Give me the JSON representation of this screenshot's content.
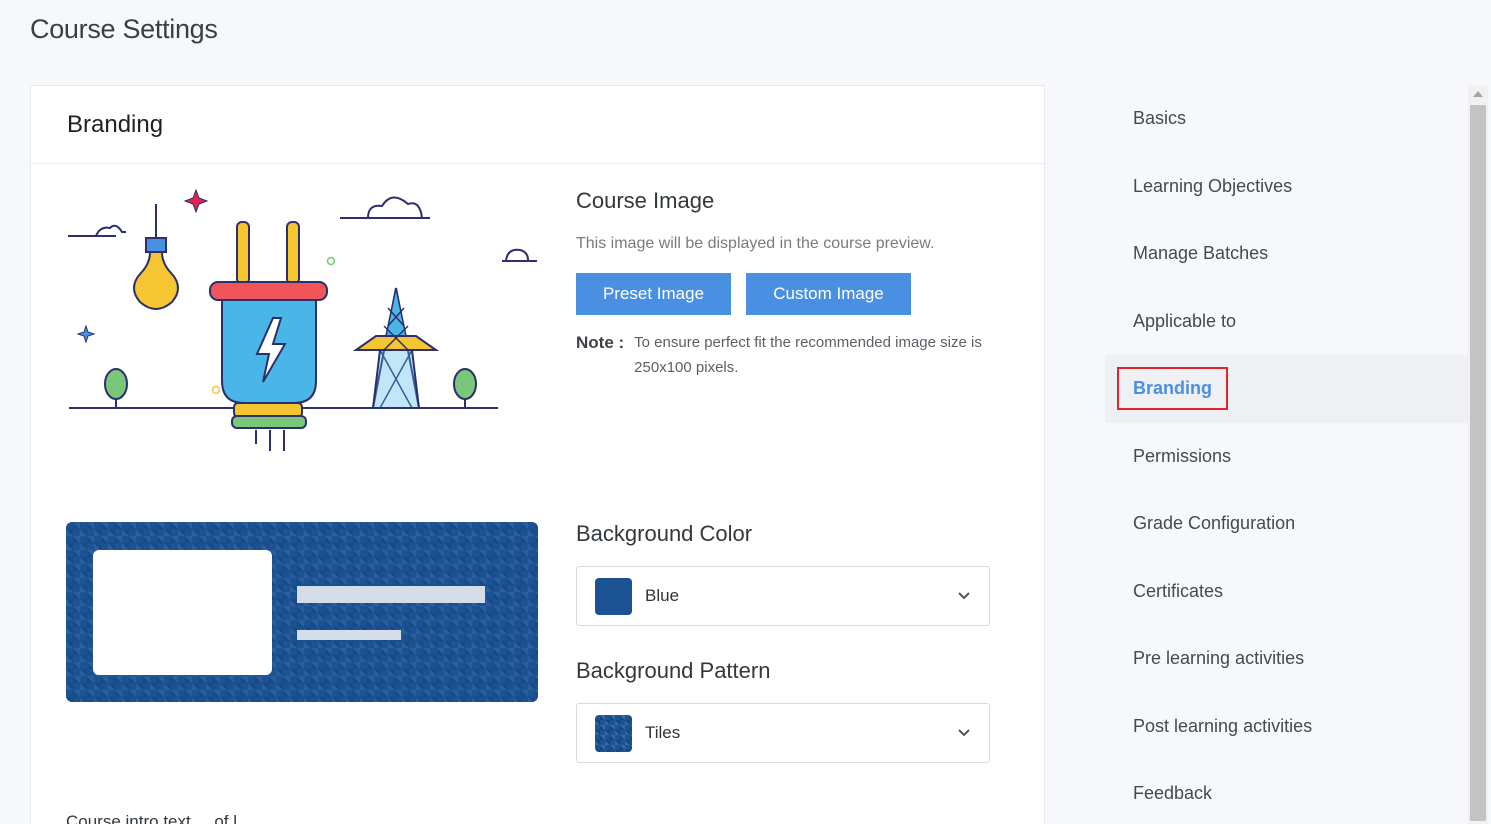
{
  "page": {
    "title": "Course Settings"
  },
  "card": {
    "title": "Branding"
  },
  "course_image": {
    "title": "Course Image",
    "description": "This image will be displayed in the course preview.",
    "preset_button": "Preset Image",
    "custom_button": "Custom Image",
    "note_label": "Note :",
    "note_text": "To ensure perfect fit the recommended image size is 250x100 pixels."
  },
  "background_color": {
    "title": "Background Color",
    "value": "Blue",
    "swatch_color": "#1b5294"
  },
  "background_pattern": {
    "title": "Background Pattern",
    "value": "Tiles"
  },
  "footer_cut_text": "Course intro text ... of l...",
  "sidebar": {
    "items": [
      {
        "label": "Basics"
      },
      {
        "label": "Learning Objectives"
      },
      {
        "label": "Manage Batches"
      },
      {
        "label": "Applicable to"
      },
      {
        "label": "Branding",
        "active": true
      },
      {
        "label": "Permissions"
      },
      {
        "label": "Grade Configuration"
      },
      {
        "label": "Certificates"
      },
      {
        "label": "Pre learning activities"
      },
      {
        "label": "Post learning activities"
      },
      {
        "label": "Feedback"
      }
    ]
  },
  "colors": {
    "accent": "#4a90e2",
    "highlight_border": "#e0242b",
    "brand_blue": "#1b5294"
  }
}
